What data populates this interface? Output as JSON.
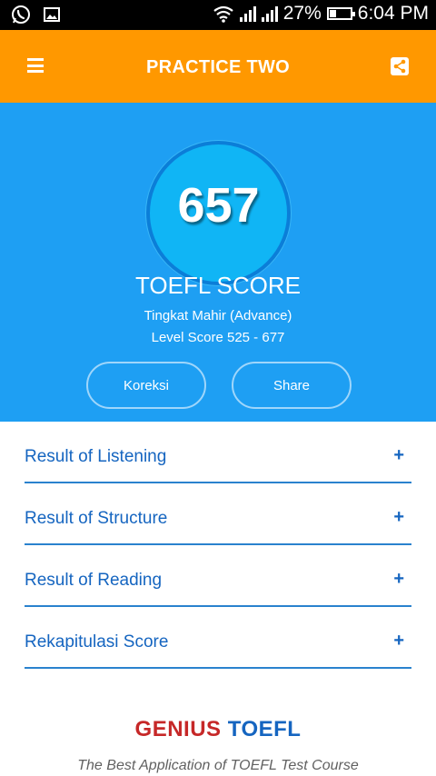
{
  "status_bar": {
    "battery": "27%",
    "time": "6:04 PM",
    "icons": [
      "whatsapp-icon",
      "image-icon",
      "wifi-icon",
      "signal-icon",
      "signal-icon",
      "battery-icon"
    ]
  },
  "app_bar": {
    "title": "PRACTICE TWO",
    "menu_icon": "hamburger-menu-icon",
    "share_icon": "share-icon"
  },
  "score": {
    "value": "657",
    "label": "TOEFL SCORE",
    "level_name": "Tingkat Mahir (Advance)",
    "level_range": "Level Score 525 - 677"
  },
  "buttons": {
    "koreksi": "Koreksi",
    "share": "Share"
  },
  "results": [
    {
      "label": "Result of Listening",
      "expand": "+"
    },
    {
      "label": "Result of Structure",
      "expand": "+"
    },
    {
      "label": "Result of Reading",
      "expand": "+"
    },
    {
      "label": "Rekapitulasi Score",
      "expand": "+"
    }
  ],
  "brand": {
    "part1": "GENIUS",
    "part2": "TOEFL",
    "tagline": "The Best Application of TOEFL Test Course"
  },
  "colors": {
    "app_bar": "#ff9800",
    "score_panel": "#1e9ff3",
    "score_circle": "#10b5f5",
    "accent_text": "#1565c0",
    "brand_red": "#c62828"
  }
}
